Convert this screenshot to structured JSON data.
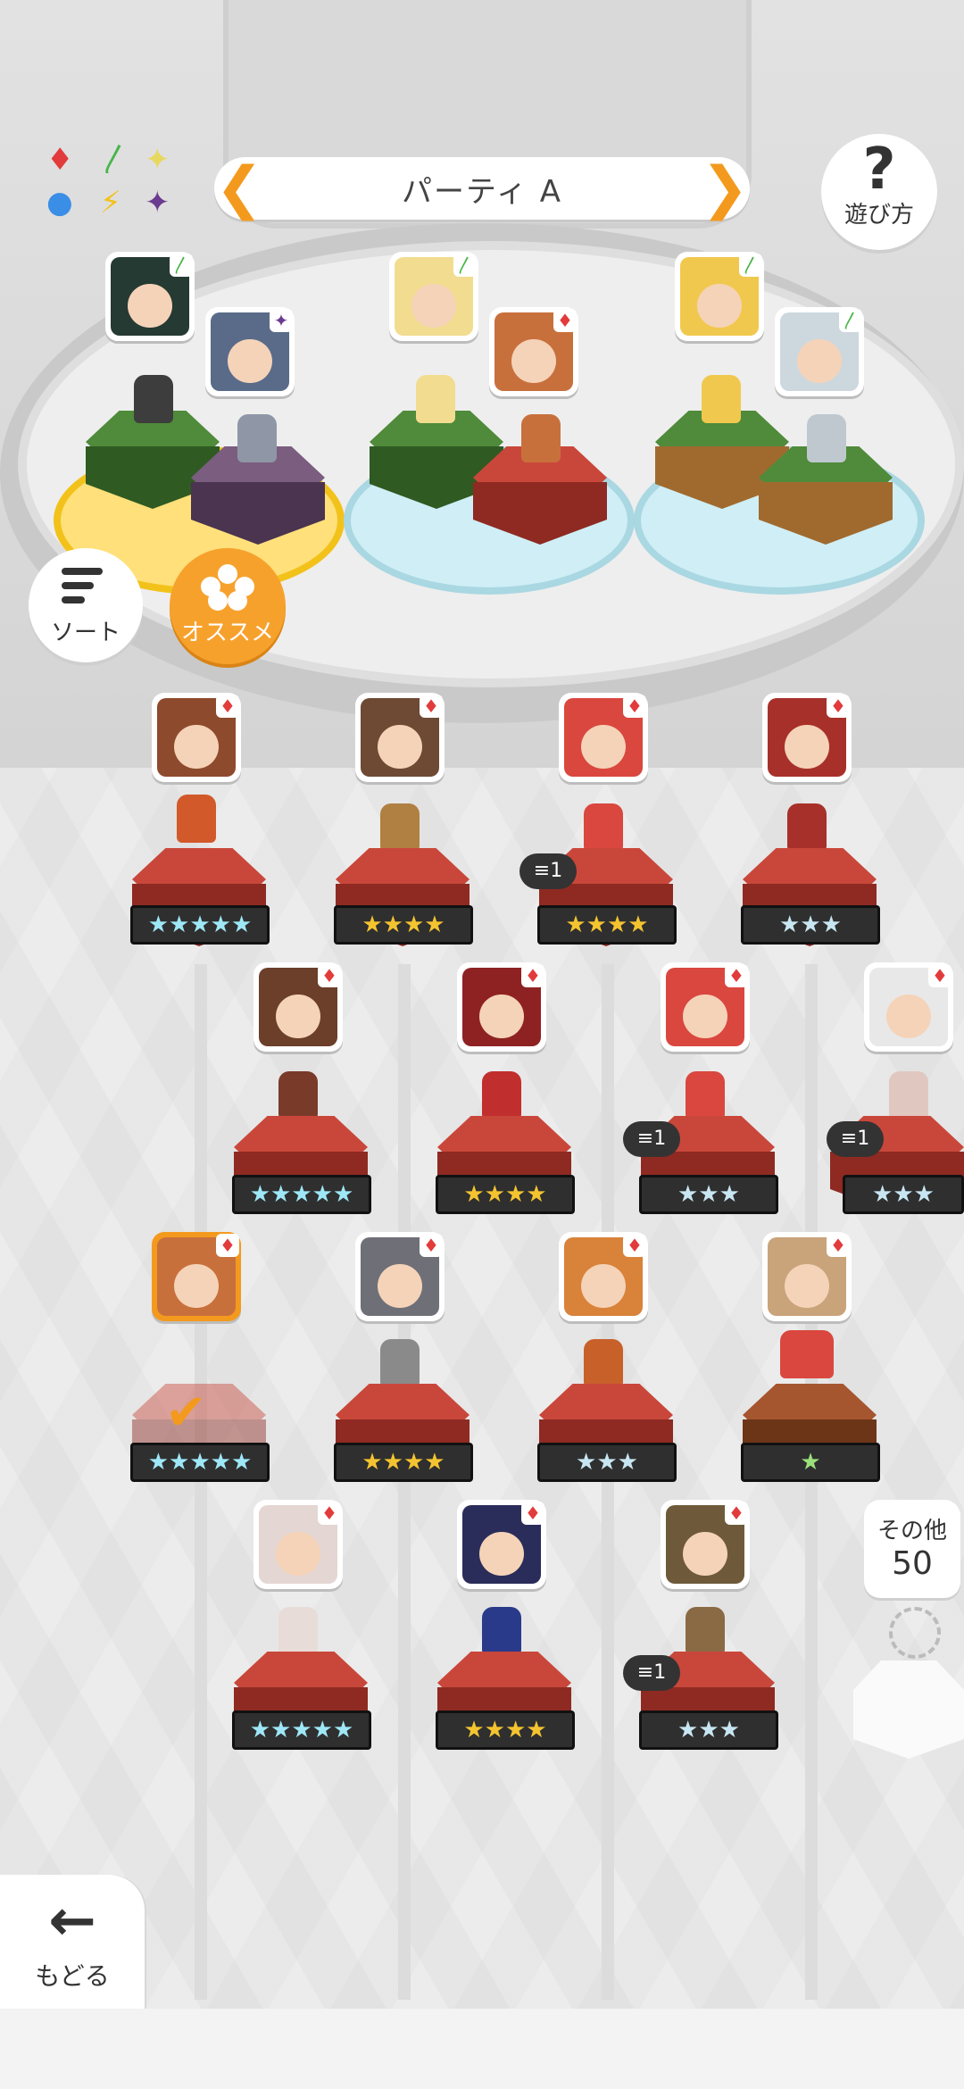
{
  "header": {
    "party_title": "パーティ A",
    "prev_arrow": "❮",
    "next_arrow": "❯",
    "help_symbol": "?",
    "help_label": "遊び方"
  },
  "legend": {
    "items": [
      "♦",
      "〳",
      "✦",
      "●",
      "⚡",
      "✦"
    ],
    "colors": [
      "#e23b3b",
      "#47b548",
      "#e7d85f",
      "#3a8ee6",
      "#f2c21b",
      "#6a3b8f"
    ]
  },
  "controls": {
    "sort_label": "ソート",
    "recommend_label": "オススメ"
  },
  "party": {
    "slots": [
      {
        "portrait": "fire-leaf-girl",
        "element": "leaf"
      },
      {
        "portrait": "old-man",
        "element": "dark"
      },
      {
        "portrait": "blonde-girl",
        "element": "leaf"
      },
      {
        "portrait": "orange-hair-girl",
        "element": "fire"
      },
      {
        "portrait": "cat-boy",
        "element": "leaf"
      },
      {
        "portrait": "white-hair-girl",
        "element": "leaf"
      }
    ]
  },
  "roster": {
    "rows": [
      [
        {
          "stars": "★★★★★",
          "tier": "rainbow",
          "dupe": ""
        },
        {
          "stars": "★★★★",
          "tier": "gold",
          "dupe": ""
        },
        {
          "stars": "★★★★",
          "tier": "gold",
          "dupe": "1"
        },
        {
          "stars": "★★★",
          "tier": "silver",
          "dupe": ""
        }
      ],
      [
        {
          "stars": "★★★★★",
          "tier": "rainbow",
          "dupe": ""
        },
        {
          "stars": "★★★★",
          "tier": "gold",
          "dupe": ""
        },
        {
          "stars": "★★★",
          "tier": "silver",
          "dupe": "1"
        },
        {
          "stars": "★★★",
          "tier": "silver",
          "dupe": "1"
        }
      ],
      [
        {
          "stars": "★★★★★",
          "tier": "rainbow",
          "dupe": ""
        },
        {
          "stars": "★★★★",
          "tier": "gold",
          "dupe": ""
        },
        {
          "stars": "★★★",
          "tier": "silver",
          "dupe": ""
        },
        {
          "stars": "★",
          "tier": "bronze",
          "dupe": ""
        }
      ],
      [
        {
          "stars": "★★★★★",
          "tier": "rainbow",
          "dupe": ""
        },
        {
          "stars": "★★★★",
          "tier": "gold",
          "dupe": ""
        },
        {
          "stars": "★★★",
          "tier": "silver",
          "dupe": "1"
        }
      ]
    ]
  },
  "more": {
    "label": "その他",
    "count": "50"
  },
  "footer": {
    "back_label": "もどる",
    "back_arrow": "←"
  }
}
